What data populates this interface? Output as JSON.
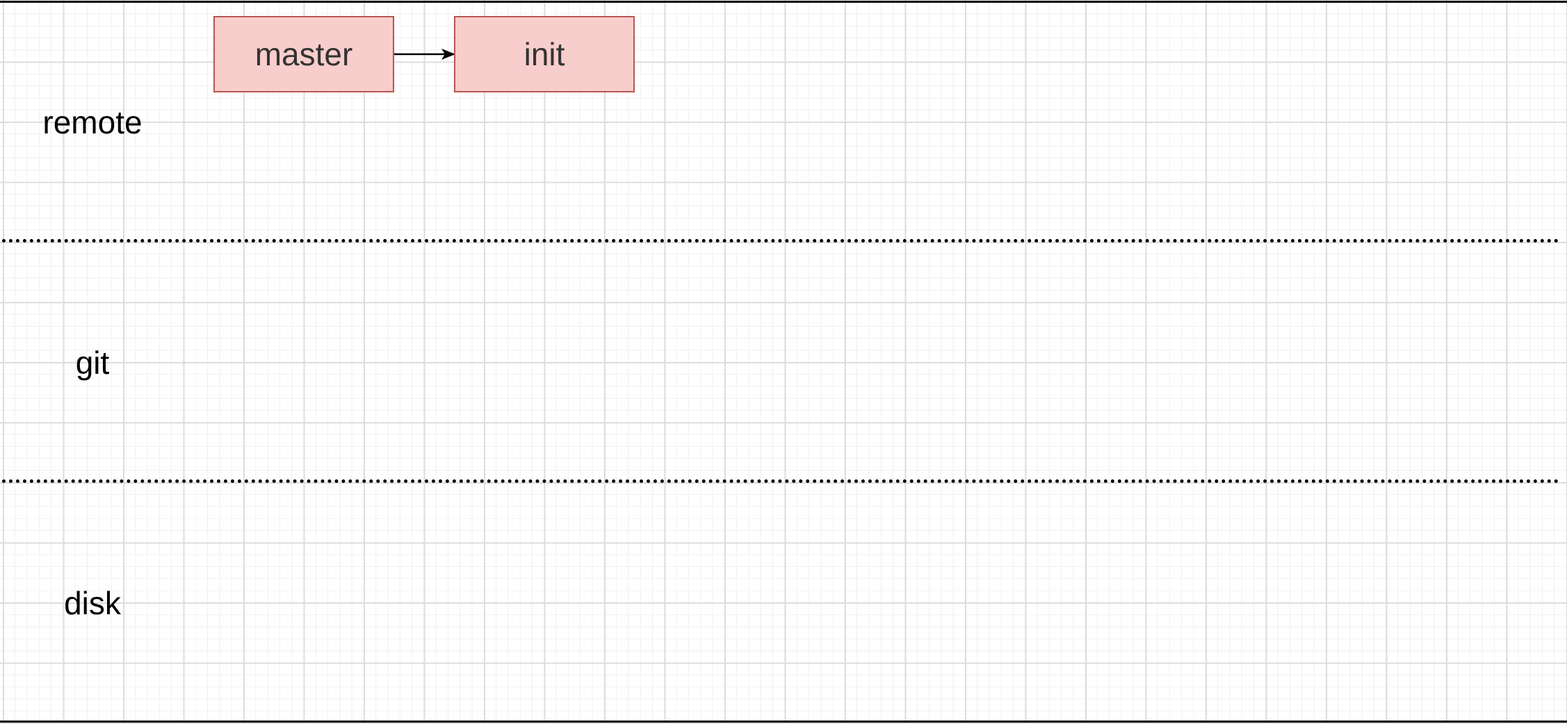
{
  "lanes": {
    "remote": "remote",
    "git": "git",
    "disk": "disk"
  },
  "nodes": {
    "master": "master",
    "init": "init"
  },
  "colors": {
    "node_fill": "#f8cecc",
    "node_stroke": "#b85450",
    "line": "#000000",
    "grid": "#dddddd"
  }
}
